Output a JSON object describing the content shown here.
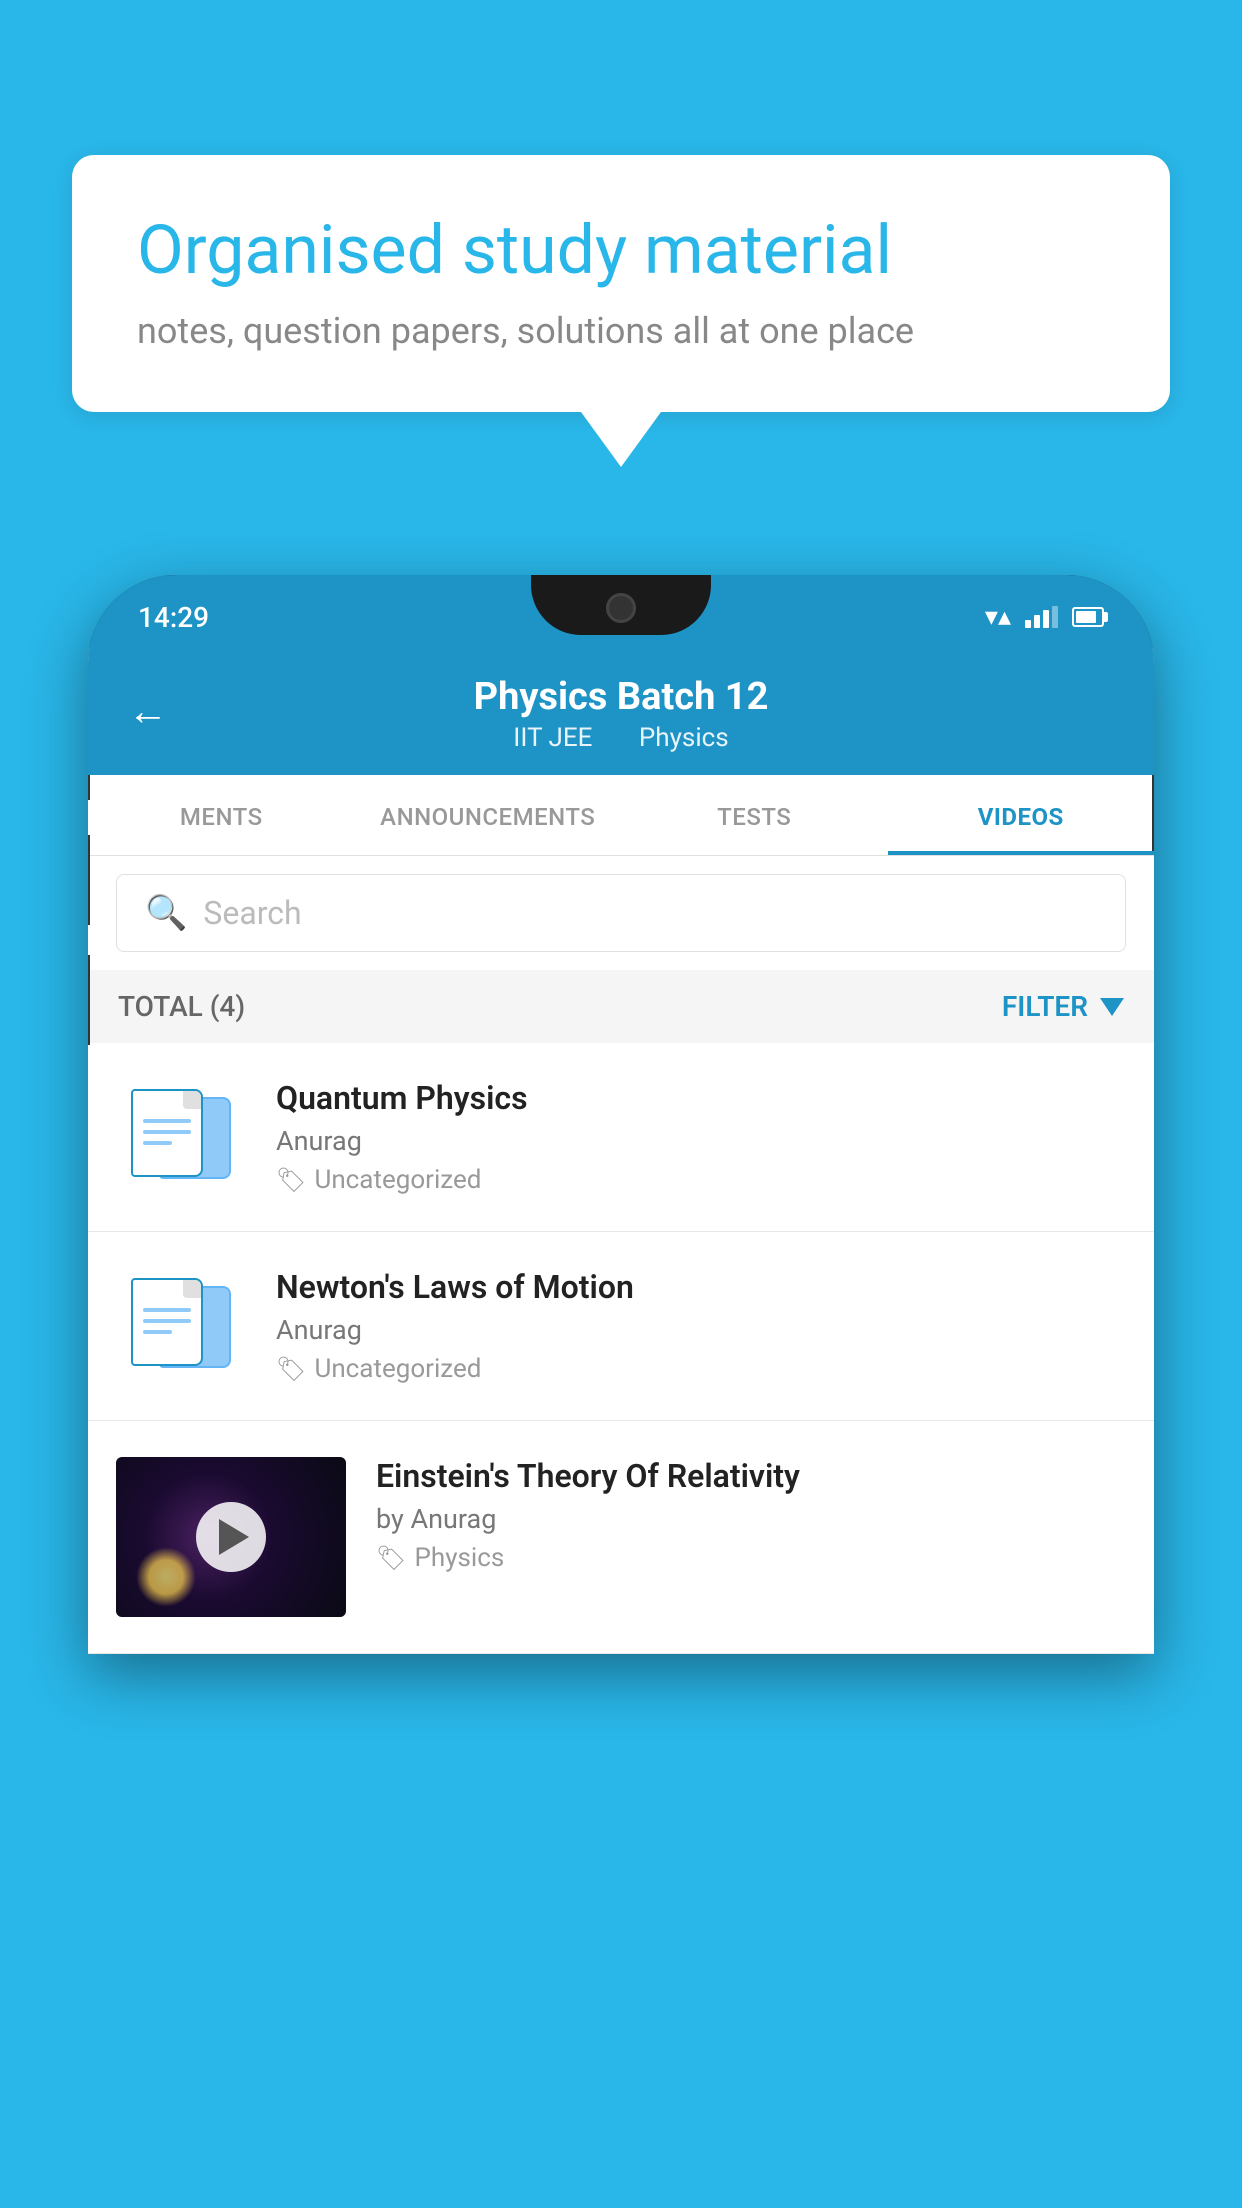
{
  "background_color": "#29B6E8",
  "speech_bubble": {
    "title": "Organised study material",
    "subtitle": "notes, question papers, solutions all at one place"
  },
  "phone": {
    "status_bar": {
      "time": "14:29"
    },
    "header": {
      "title": "Physics Batch 12",
      "subtitle_part1": "IIT JEE",
      "subtitle_part2": "Physics",
      "back_label": "←"
    },
    "tabs": [
      {
        "label": "MENTS",
        "active": false
      },
      {
        "label": "ANNOUNCEMENTS",
        "active": false
      },
      {
        "label": "TESTS",
        "active": false
      },
      {
        "label": "VIDEOS",
        "active": true
      }
    ],
    "search": {
      "placeholder": "Search"
    },
    "filter_bar": {
      "total_label": "TOTAL (4)",
      "filter_label": "FILTER"
    },
    "videos": [
      {
        "title": "Quantum Physics",
        "author": "Anurag",
        "tag": "Uncategorized",
        "has_thumbnail": false
      },
      {
        "title": "Newton's Laws of Motion",
        "author": "Anurag",
        "tag": "Uncategorized",
        "has_thumbnail": false
      },
      {
        "title": "Einstein's Theory Of Relativity",
        "author": "by Anurag",
        "tag": "Physics",
        "has_thumbnail": true
      }
    ]
  }
}
